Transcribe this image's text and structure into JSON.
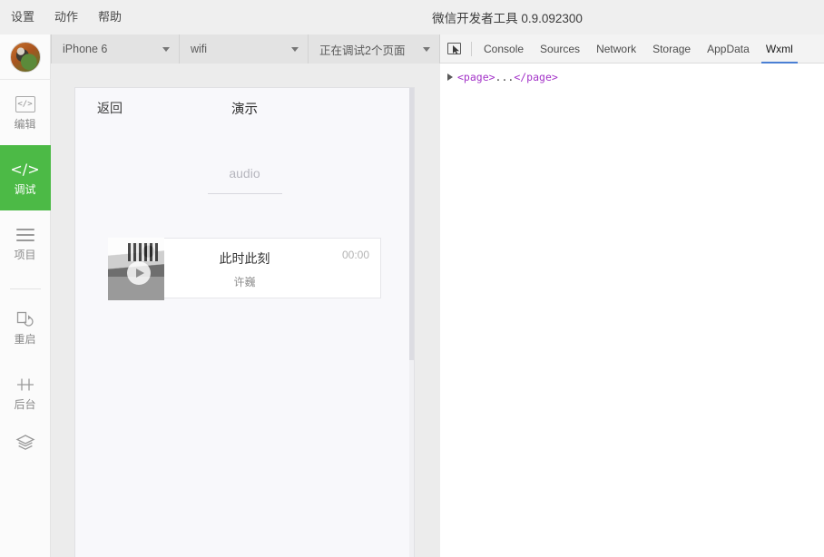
{
  "window": {
    "title": "微信开发者工具 0.9.092300",
    "menu": [
      {
        "label": "设置",
        "name": "menu-settings"
      },
      {
        "label": "动作",
        "name": "menu-actions"
      },
      {
        "label": "帮助",
        "name": "menu-help"
      }
    ]
  },
  "toolbar": {
    "device": {
      "value": "iPhone 6",
      "name": "device-select"
    },
    "network": {
      "value": "wifi",
      "name": "network-select"
    },
    "debug_target": {
      "value": "正在调试2个页面",
      "name": "debug-target-select"
    },
    "inspect_icon": "inspect-element-icon"
  },
  "devtools": {
    "tabs": [
      {
        "label": "Console",
        "active": false
      },
      {
        "label": "Sources",
        "active": false
      },
      {
        "label": "Network",
        "active": false
      },
      {
        "label": "Storage",
        "active": false
      },
      {
        "label": "AppData",
        "active": false
      },
      {
        "label": "Wxml",
        "active": true
      }
    ],
    "active_tab": "Wxml",
    "accent_color": "#4a7fd4",
    "wxml": {
      "arrow": "collapsed",
      "open_tag": "<page>",
      "ellipsis": "...",
      "close_tag": "</page>"
    }
  },
  "sidebar": {
    "avatar": "user-avatar",
    "items": [
      {
        "label": "编辑",
        "icon": "code-box-icon",
        "active": false
      },
      {
        "label": "调试",
        "icon": "code-brackets-icon",
        "active": true
      },
      {
        "label": "项目",
        "icon": "list-icon",
        "active": false
      },
      {
        "label": "重启",
        "icon": "restart-icon",
        "active": false
      },
      {
        "label": "后台",
        "icon": "background-icon",
        "active": false
      },
      {
        "label": "",
        "icon": "layers-icon",
        "active": false
      }
    ],
    "active_color": "#4cba46"
  },
  "simulator": {
    "nav": {
      "back_label": "返回",
      "title": "演示"
    },
    "section_label": "audio",
    "audio_card": {
      "thumbnail": "album-art-thumbnail",
      "play_icon": "play-button-icon",
      "title": "此时此刻",
      "artist": "许巍",
      "time": "00:00"
    }
  }
}
